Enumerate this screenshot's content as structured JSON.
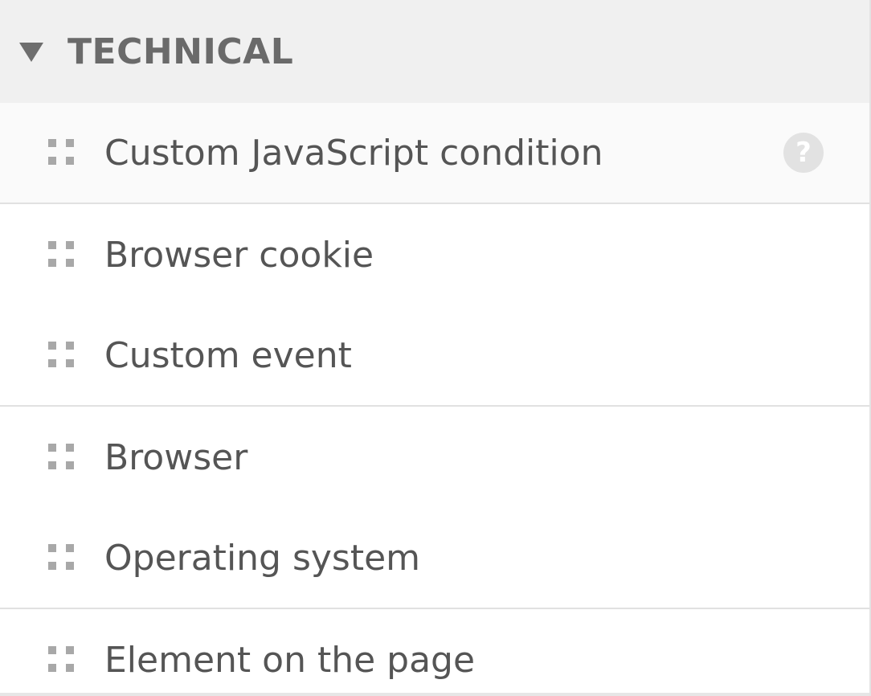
{
  "section": {
    "title": "TECHNICAL",
    "expanded": true
  },
  "items": [
    {
      "label": "Custom JavaScript condition",
      "help_icon": "question-icon",
      "help_glyph": "?"
    },
    {
      "label": "Browser cookie"
    },
    {
      "label": "Custom event"
    },
    {
      "label": "Browser"
    },
    {
      "label": "Operating system"
    },
    {
      "label": "Element on the page"
    }
  ],
  "colors": {
    "header_bg": "#f0f0f0",
    "text": "#555555",
    "icon": "#a8a8a8"
  }
}
